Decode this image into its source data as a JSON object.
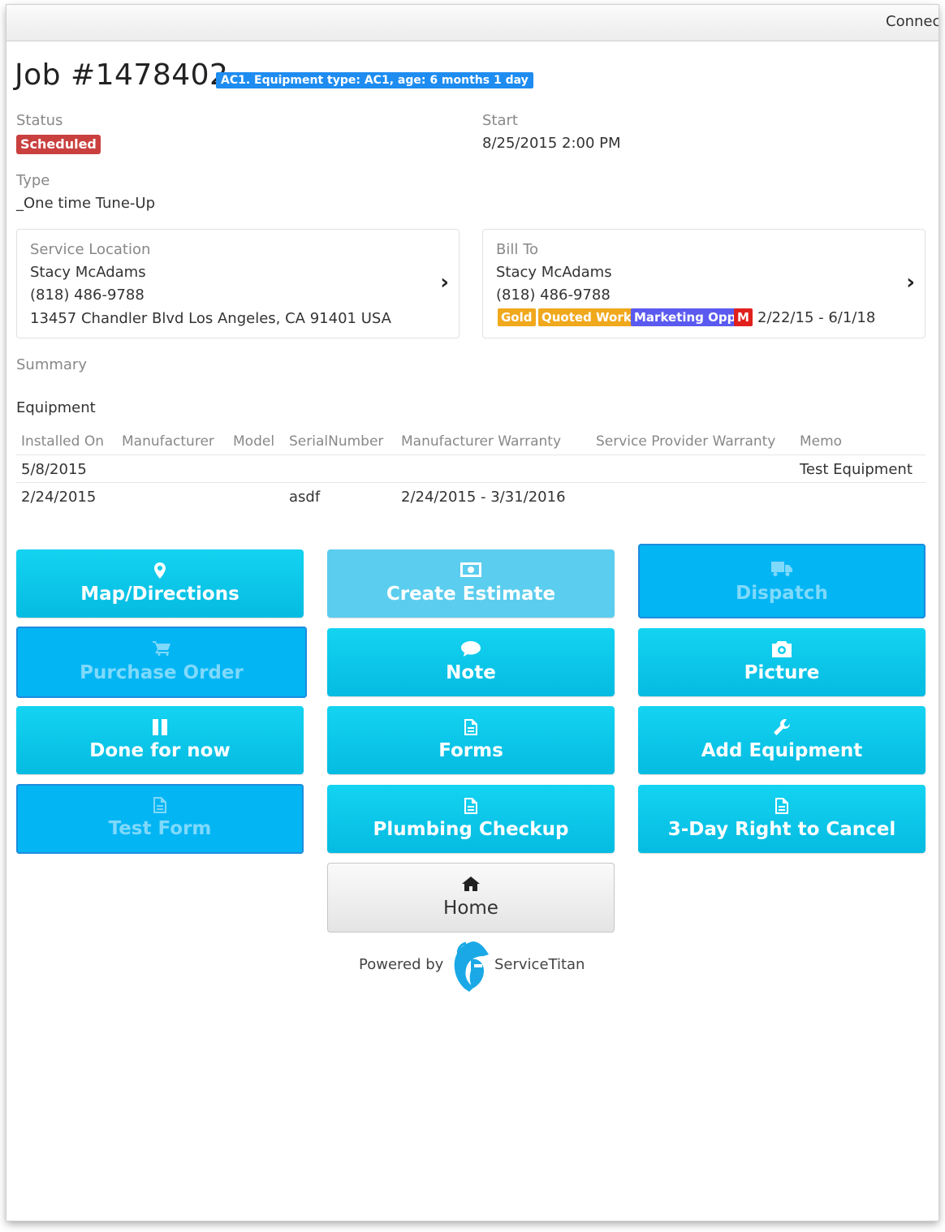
{
  "topbar": {
    "connection_text": "Connec"
  },
  "job": {
    "title": "Job #1478402",
    "equipment_badge": "AC1. Equipment type: AC1, age: 6 months 1 day",
    "status_label": "Status",
    "status": "Scheduled",
    "start_label": "Start",
    "start": "8/25/2015 2:00 PM",
    "type_label": "Type",
    "type": "_One time Tune-Up"
  },
  "service_location": {
    "label": "Service Location",
    "name": "Stacy McAdams",
    "phone": "(818) 486-9788",
    "address": "13457 Chandler Blvd Los Angeles, CA 91401 USA"
  },
  "bill_to": {
    "label": "Bill To",
    "name": "Stacy McAdams",
    "phone": "(818) 486-9788",
    "tags": [
      {
        "text": "Gold",
        "color": "#f0a81c"
      },
      {
        "text": "Quoted Work",
        "color": "#f0a81c"
      },
      {
        "text": "Marketing Opp",
        "color": "#5a5af0"
      },
      {
        "text": "M",
        "color": "#e0201c"
      }
    ],
    "dates": "2/22/15 - 6/1/18"
  },
  "summary_label": "Summary",
  "equipment": {
    "title": "Equipment",
    "columns": [
      "Installed On",
      "Manufacturer",
      "Model",
      "SerialNumber",
      "Manufacturer Warranty",
      "Service Provider Warranty",
      "Memo"
    ],
    "rows": [
      {
        "installed_on": "5/8/2015",
        "manufacturer": "",
        "model": "",
        "serial": "",
        "mfr_warranty": "",
        "sp_warranty": "",
        "memo": "Test Equipment"
      },
      {
        "installed_on": "2/24/2015",
        "manufacturer": "",
        "model": "",
        "serial": "asdf",
        "mfr_warranty": "2/24/2015 - 3/31/2016",
        "sp_warranty": "",
        "memo": ""
      }
    ]
  },
  "actions": {
    "map": {
      "label": "Map/Directions",
      "icon": "map-marker-icon"
    },
    "estimate": {
      "label": "Create Estimate",
      "icon": "money-icon"
    },
    "dispatch": {
      "label": "Dispatch",
      "icon": "truck-icon"
    },
    "purchase_order": {
      "label": "Purchase Order",
      "icon": "cart-icon"
    },
    "note": {
      "label": "Note",
      "icon": "comment-icon"
    },
    "picture": {
      "label": "Picture",
      "icon": "camera-icon"
    },
    "done": {
      "label": "Done for now",
      "icon": "pause-icon"
    },
    "forms": {
      "label": "Forms",
      "icon": "document-icon"
    },
    "add_equipment": {
      "label": "Add Equipment",
      "icon": "wrench-icon"
    },
    "test_form": {
      "label": "Test Form",
      "icon": "document-icon"
    },
    "plumbing": {
      "label": "Plumbing Checkup",
      "icon": "document-icon"
    },
    "cancel": {
      "label": "3-Day Right to Cancel",
      "icon": "document-icon"
    },
    "home": {
      "label": "Home",
      "icon": "home-icon"
    }
  },
  "footer": {
    "powered_by": "Powered by",
    "brand": "ServiceTitan"
  },
  "colors": {
    "accent": "#05bbe1",
    "selected": "#04b5f4",
    "status": "#c9403e",
    "badge": "#1e8cf0"
  }
}
